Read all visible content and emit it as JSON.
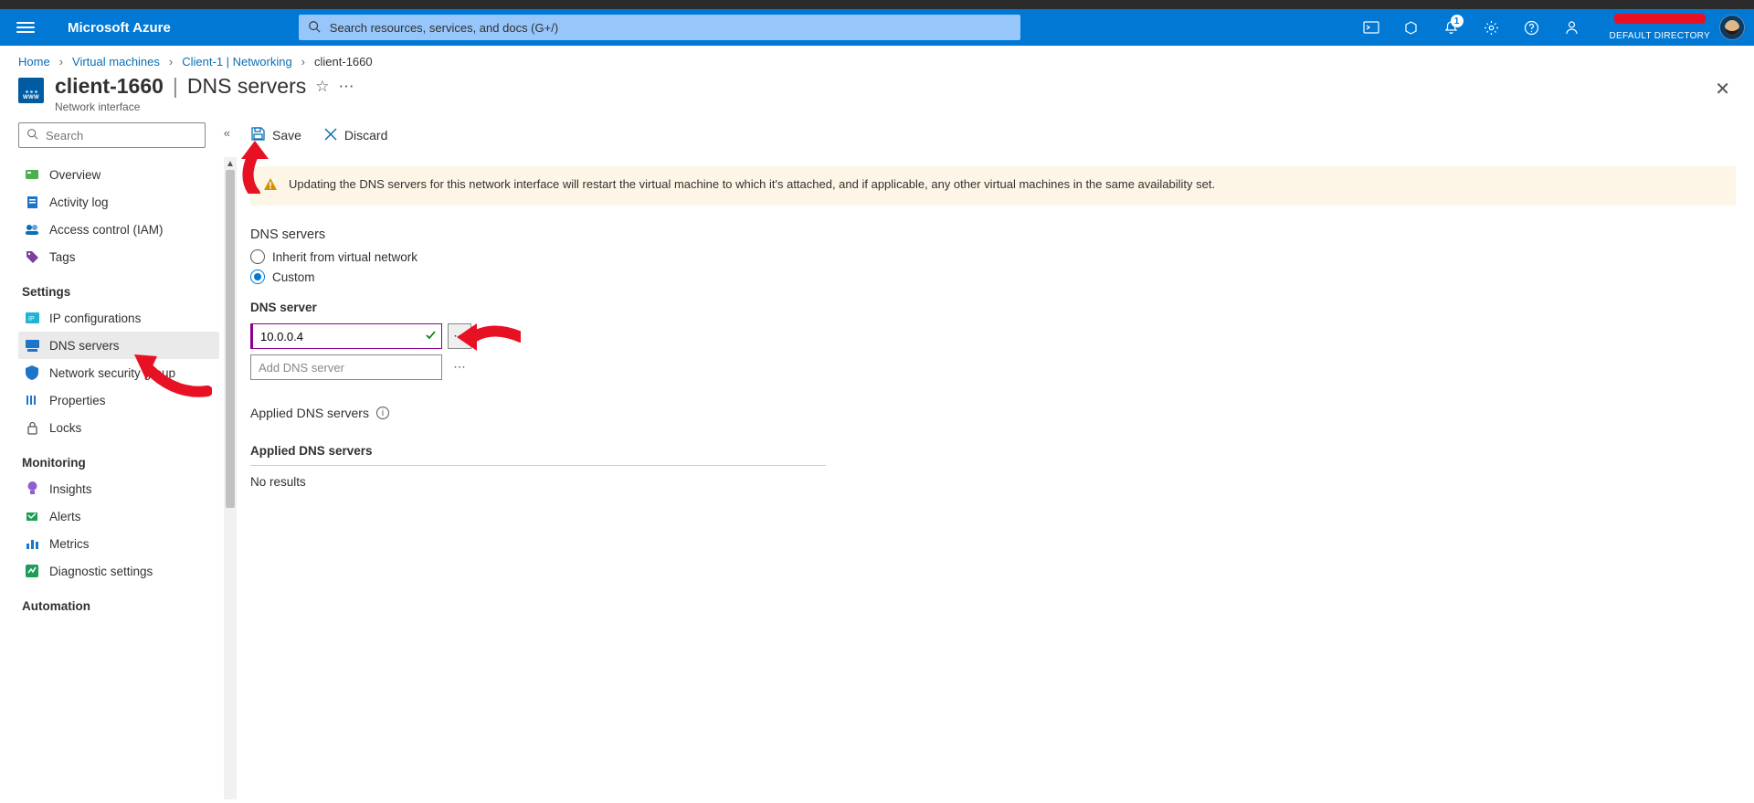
{
  "navbar": {
    "brand": "Microsoft Azure",
    "search_placeholder": "Search resources, services, and docs (G+/)",
    "notification_count": "1",
    "directory_label": "DEFAULT DIRECTORY"
  },
  "breadcrumb": {
    "items": [
      {
        "label": "Home",
        "link": true
      },
      {
        "label": "Virtual machines",
        "link": true
      },
      {
        "label": "Client-1 | Networking",
        "link": true
      },
      {
        "label": "client-1660",
        "link": false
      }
    ]
  },
  "blade": {
    "title_main": "client-1660",
    "title_sep": "|",
    "title_sub": "DNS servers",
    "subtitle": "Network interface"
  },
  "sidebar": {
    "search_placeholder": "Search",
    "top_items": [
      {
        "label": "Overview",
        "icon": "overview-icon"
      },
      {
        "label": "Activity log",
        "icon": "activity-log-icon"
      },
      {
        "label": "Access control (IAM)",
        "icon": "access-control-icon"
      },
      {
        "label": "Tags",
        "icon": "tags-icon"
      }
    ],
    "sections": [
      {
        "title": "Settings",
        "items": [
          {
            "label": "IP configurations",
            "icon": "ip-config-icon",
            "active": false
          },
          {
            "label": "DNS servers",
            "icon": "dns-servers-icon",
            "active": true
          },
          {
            "label": "Network security group",
            "icon": "nsg-icon",
            "active": false
          },
          {
            "label": "Properties",
            "icon": "properties-icon",
            "active": false
          },
          {
            "label": "Locks",
            "icon": "locks-icon",
            "active": false
          }
        ]
      },
      {
        "title": "Monitoring",
        "items": [
          {
            "label": "Insights",
            "icon": "insights-icon"
          },
          {
            "label": "Alerts",
            "icon": "alerts-icon"
          },
          {
            "label": "Metrics",
            "icon": "metrics-icon"
          },
          {
            "label": "Diagnostic settings",
            "icon": "diagnostic-icon"
          }
        ]
      },
      {
        "title": "Automation",
        "items": []
      }
    ]
  },
  "commands": {
    "save": "Save",
    "discard": "Discard"
  },
  "warning": "Updating the DNS servers for this network interface will restart the virtual machine to which it's attached, and if applicable, any other virtual machines in the same availability set.",
  "dns": {
    "section_label": "DNS servers",
    "options": {
      "inherit": "Inherit from virtual network",
      "custom": "Custom"
    },
    "selected": "custom",
    "server_label": "DNS server",
    "entries": [
      "10.0.0.4"
    ],
    "add_placeholder": "Add DNS server"
  },
  "applied": {
    "title": "Applied DNS servers",
    "column": "Applied DNS servers",
    "empty": "No results"
  }
}
